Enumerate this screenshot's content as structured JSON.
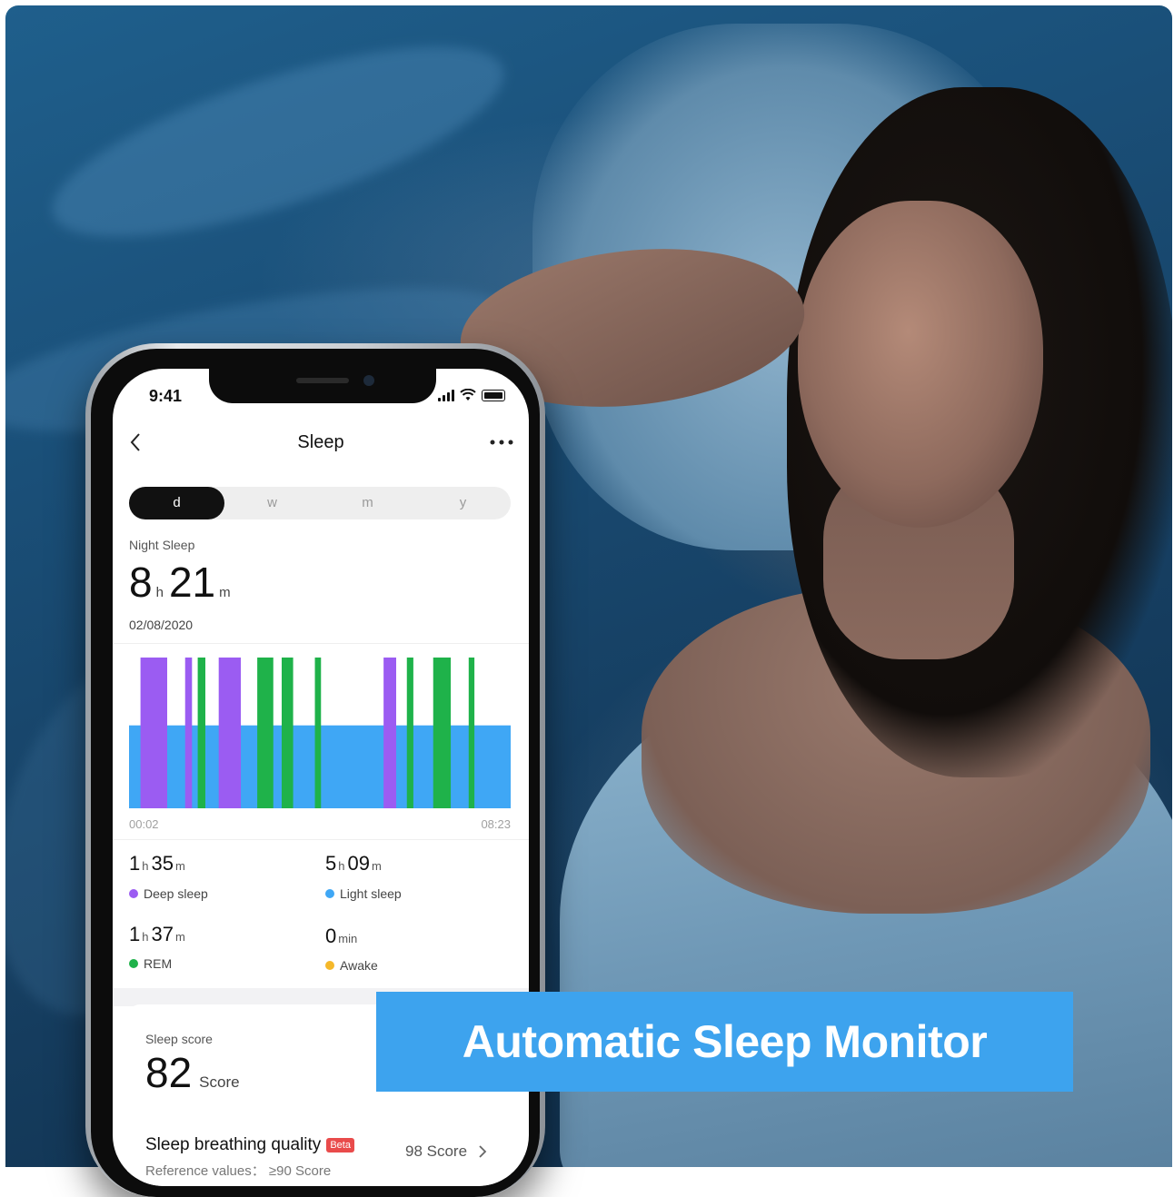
{
  "colors": {
    "deep": "#9b5cf2",
    "light": "#3fa7f5",
    "rem": "#1fb24a",
    "awake": "#f5b82a",
    "banner": "#3da3ee"
  },
  "status_bar": {
    "time": "9:41"
  },
  "header": {
    "title": "Sleep",
    "back_icon": "chevron-left-icon",
    "more_icon": "more-horizontal-icon"
  },
  "tabs": [
    {
      "label": "d",
      "active": true
    },
    {
      "label": "w",
      "active": false
    },
    {
      "label": "m",
      "active": false
    },
    {
      "label": "y",
      "active": false
    }
  ],
  "night_sleep": {
    "label": "Night Sleep",
    "hours": "8",
    "hours_unit": "h",
    "minutes": "21",
    "minutes_unit": "m",
    "date": "02/08/2020"
  },
  "chart_data": {
    "type": "bar",
    "x_start": "00:02",
    "x_end": "08:23",
    "light_level": 0.55,
    "segments": [
      {
        "stage": "deep",
        "start": 0.03,
        "end": 0.1
      },
      {
        "stage": "deep",
        "start": 0.147,
        "end": 0.165
      },
      {
        "stage": "rem",
        "start": 0.18,
        "end": 0.2
      },
      {
        "stage": "deep",
        "start": 0.235,
        "end": 0.293
      },
      {
        "stage": "rem",
        "start": 0.336,
        "end": 0.378
      },
      {
        "stage": "rem",
        "start": 0.4,
        "end": 0.43
      },
      {
        "stage": "rem",
        "start": 0.487,
        "end": 0.503
      },
      {
        "stage": "deep",
        "start": 0.667,
        "end": 0.7
      },
      {
        "stage": "rem",
        "start": 0.728,
        "end": 0.745
      },
      {
        "stage": "rem",
        "start": 0.797,
        "end": 0.843
      },
      {
        "stage": "rem",
        "start": 0.89,
        "end": 0.905
      }
    ]
  },
  "stats": {
    "deep": {
      "h": "1",
      "m": "35",
      "label": "Deep sleep"
    },
    "light": {
      "h": "5",
      "m": "09",
      "label": "Light sleep"
    },
    "rem": {
      "h": "1",
      "m": "37",
      "label": "REM"
    },
    "awake": {
      "v": "0",
      "unit": "min",
      "label": "Awake"
    },
    "h_unit": "h",
    "m_unit": "m"
  },
  "score": {
    "label": "Sleep score",
    "value": "82",
    "unit": "Score",
    "breathing_label": "Sleep breathing quality",
    "beta": "Beta",
    "reference": "Reference values： ≥90 Score",
    "breathing_value": "98 Score"
  },
  "banner": {
    "text": "Automatic Sleep Monitor"
  }
}
